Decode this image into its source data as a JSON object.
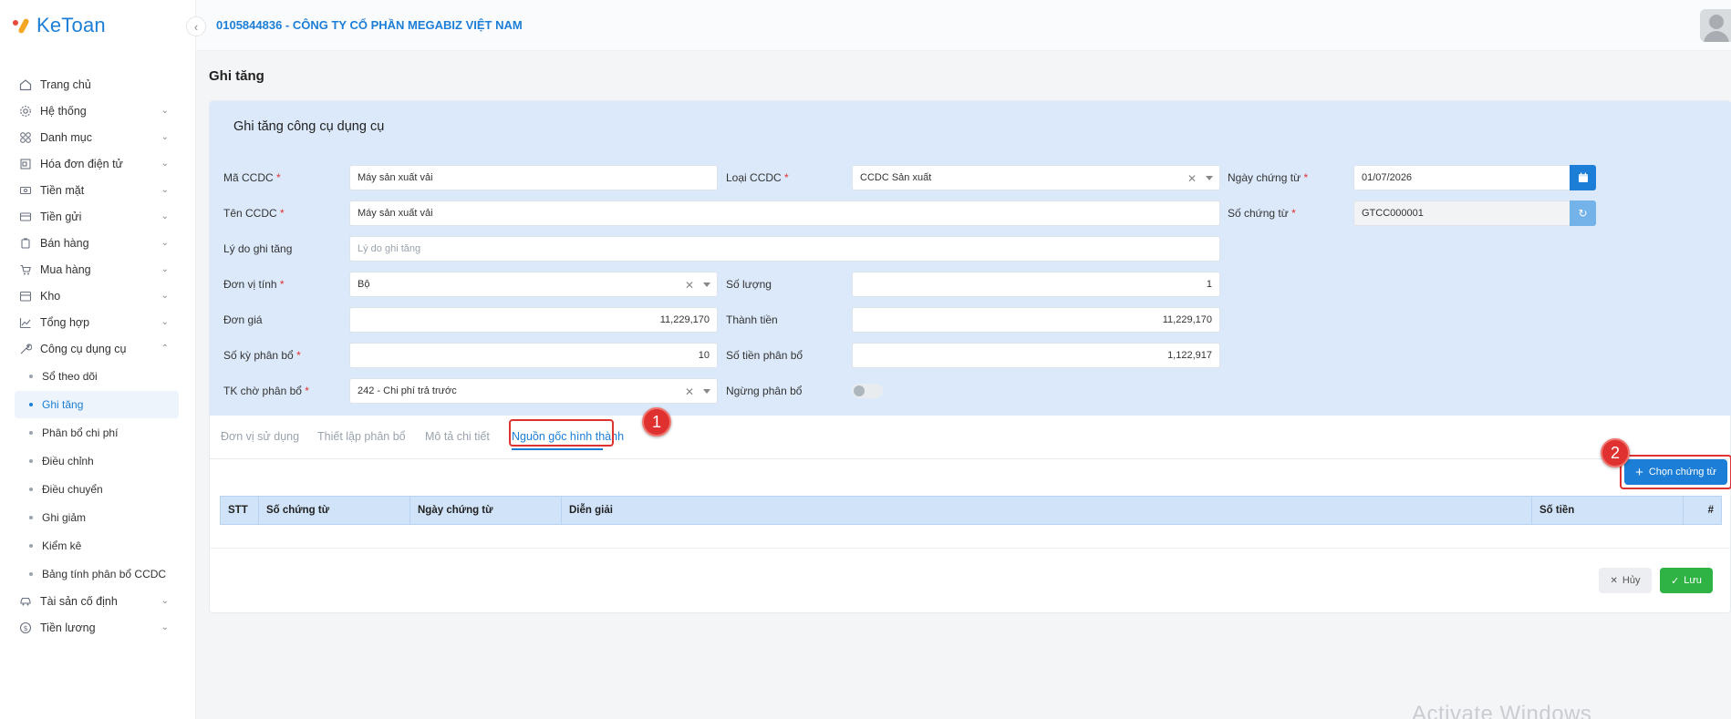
{
  "app": {
    "logo_text": "KeToan",
    "company": "0105844836 - CÔNG TY CỔ PHẦN MEGABIZ VIỆT NAM"
  },
  "sidebar": {
    "items": [
      {
        "label": "Trang chủ",
        "icon": "home-icon",
        "chevron": false
      },
      {
        "label": "Hệ thống",
        "icon": "gear-icon",
        "chevron": true
      },
      {
        "label": "Danh mục",
        "icon": "grid-icon",
        "chevron": true
      },
      {
        "label": "Hóa đơn điện tử",
        "icon": "invoice-icon",
        "chevron": true
      },
      {
        "label": "Tiền mặt",
        "icon": "cash-icon",
        "chevron": true
      },
      {
        "label": "Tiền gửi",
        "icon": "card-icon",
        "chevron": true
      },
      {
        "label": "Bán hàng",
        "icon": "sales-icon",
        "chevron": true
      },
      {
        "label": "Mua hàng",
        "icon": "cart-icon",
        "chevron": true
      },
      {
        "label": "Kho",
        "icon": "warehouse-icon",
        "chevron": true
      },
      {
        "label": "Tổng hợp",
        "icon": "chart-icon",
        "chevron": true
      },
      {
        "label": "Công cụ dụng cụ",
        "icon": "tools-icon",
        "chevron": true,
        "expanded": true
      }
    ],
    "sub_items": [
      "Sổ theo dõi",
      "Ghi tăng",
      "Phân bổ chi phí",
      "Điều chỉnh",
      "Điều chuyển",
      "Ghi giảm",
      "Kiểm kê",
      "Bảng tính phân bổ CCDC"
    ],
    "bottom_items": [
      {
        "label": "Tài sản cố định",
        "icon": "car-icon",
        "chevron": true
      },
      {
        "label": "Tiền lương",
        "icon": "salary-icon",
        "chevron": true
      }
    ]
  },
  "page": {
    "title": "Ghi tăng",
    "section_title": "Ghi tăng công cụ dụng cụ"
  },
  "form": {
    "ma_ccdc": {
      "label": "Mã CCDC",
      "value": "Máy sản xuất vải"
    },
    "loai_ccdc": {
      "label": "Loại CCDC",
      "value": "CCDC Sản xuất"
    },
    "ngay_chung_tu": {
      "label": "Ngày chứng từ",
      "value": "01/07/2026"
    },
    "ten_ccdc": {
      "label": "Tên CCDC",
      "value": "Máy sản xuất vải"
    },
    "so_chung_tu": {
      "label": "Số chứng từ",
      "value": "GTCC000001"
    },
    "ly_do": {
      "label": "Lý do ghi tăng",
      "placeholder": "Lý do ghi tăng"
    },
    "don_vi_tinh": {
      "label": "Đơn vị tính",
      "value": "Bộ"
    },
    "so_luong": {
      "label": "Số lượng",
      "value": "1"
    },
    "don_gia": {
      "label": "Đơn giá",
      "value": "11,229,170"
    },
    "thanh_tien": {
      "label": "Thành tiền",
      "value": "11,229,170"
    },
    "so_ky": {
      "label": "Số kỳ phân bổ",
      "value": "10"
    },
    "so_tien_pb": {
      "label": "Số tiền phân bổ",
      "value": "1,122,917"
    },
    "tk_cho": {
      "label": "TK chờ phân bổ",
      "value": "242 - Chi phí trả trước"
    },
    "ngung_pb": {
      "label": "Ngừng phân bổ",
      "on": false
    },
    "required_mark": "*"
  },
  "tabs": [
    "Đơn vị sử dụng",
    "Thiết lập phân bổ",
    "Mô tả chi tiết",
    "Nguồn gốc hình thành"
  ],
  "active_tab": 3,
  "markers": [
    "1",
    "2"
  ],
  "actions": {
    "pick": "Chọn chứng từ",
    "cancel": "Hủy",
    "save": "Lưu"
  },
  "table": {
    "columns": [
      "STT",
      "Số chứng từ",
      "Ngày chứng từ",
      "Diễn giải",
      "Số tiền",
      "#"
    ]
  },
  "watermark": "Activate Windows",
  "colors": {
    "primary": "#1c7ed6",
    "panel": "#dbe9fa",
    "danger": "#e03131",
    "success": "#2fb344"
  }
}
